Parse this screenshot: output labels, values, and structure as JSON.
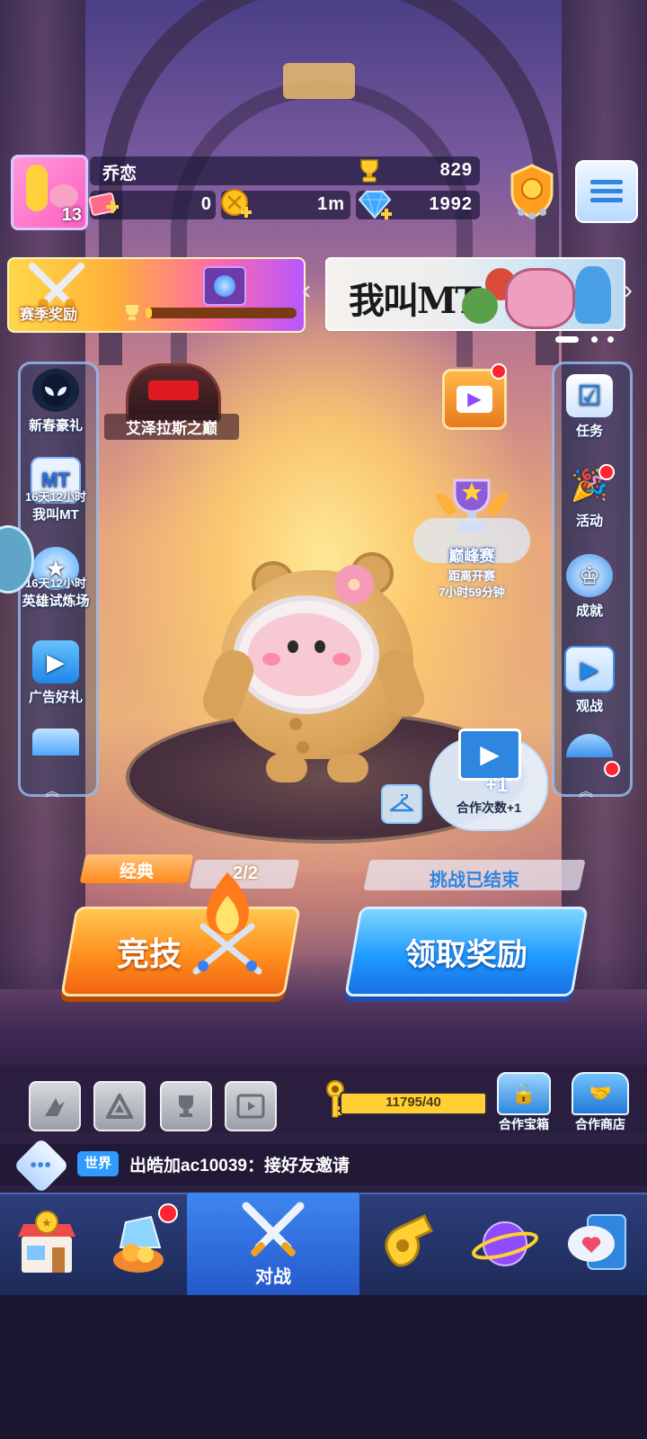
{
  "player": {
    "name": "乔恋",
    "level": "13",
    "trophies": "829",
    "tickets": "0",
    "coins_label": "1m",
    "gems": "1992"
  },
  "banners": {
    "season_reward": "赛季奖励",
    "event_banner_title": "我叫MT"
  },
  "left_panel": {
    "items": [
      {
        "label": "新春豪礼",
        "icon": "venom-mask-icon"
      },
      {
        "label": "我叫MT",
        "timer": "16天12小时",
        "icon": "mt-logo-icon"
      },
      {
        "label": "英雄试炼场",
        "timer": "16天12小时",
        "icon": "star-badge-icon"
      },
      {
        "label": "广告好礼",
        "icon": "video-gift-icon"
      }
    ]
  },
  "right_panel": {
    "items": [
      {
        "label": "任务",
        "icon": "checkbox-icon"
      },
      {
        "label": "活动",
        "icon": "party-popper-icon"
      },
      {
        "label": "成就",
        "icon": "crown-star-icon"
      },
      {
        "label": "观战",
        "icon": "tv-play-icon"
      }
    ]
  },
  "center": {
    "boss_label": "艾泽拉斯之巅",
    "peak_match_title": "巅峰赛",
    "peak_countdown_label": "距离开赛",
    "peak_countdown": "7小时59分钟",
    "coop_bonus": "合作次数+1",
    "coop_plus": "+1"
  },
  "mode": {
    "left_tag": "经典",
    "left_score": "2/2",
    "right_tag": "挑战已结束",
    "compete_button": "竞技",
    "claim_button": "领取奖励"
  },
  "bottom_tools": {
    "key_progress": "11795/40",
    "coop_chest": "合作宝箱",
    "coop_shop": "合作商店"
  },
  "chat": {
    "channel": "世界",
    "message": "出皓加ac10039：接好友邀请"
  },
  "nav": {
    "active_label": "对战",
    "tabs": [
      "shop-icon",
      "egg-capsule-icon",
      "crossed-swords-icon",
      "whistle-icon",
      "planet-icon",
      "chat-heart-icon"
    ]
  },
  "colors": {
    "accent_blue": "#1f9bff",
    "accent_orange": "#ff8a1e",
    "badge_red": "#ff2430",
    "nav_active": "#2f6fe0"
  }
}
